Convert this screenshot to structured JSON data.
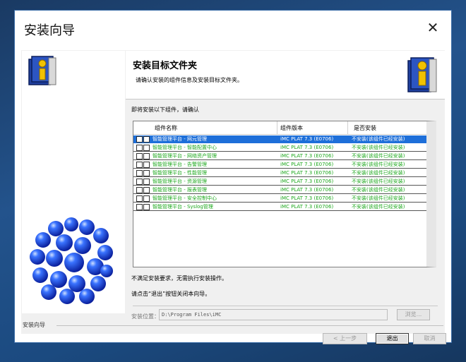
{
  "window": {
    "title": "安装向导",
    "close_glyph": "✕"
  },
  "header": {
    "title": "安装目标文件夹",
    "subtitle": "请确认安装的组件信息及安装目标文件夹。"
  },
  "body": {
    "prompt": "即将安装以下组件，请确认",
    "columns": [
      "组件名称",
      "组件版本",
      "是否安装"
    ],
    "rows": [
      {
        "name": "智能管理平台 - 网元管理",
        "version": "iMC PLAT 7.3 (E0706)",
        "status": "不安装(该组件已经安装)",
        "selected": true
      },
      {
        "name": "智能管理平台 - 智能配置中心",
        "version": "iMC PLAT 7.3 (E0706)",
        "status": "不安装(该组件已经安装)",
        "selected": false
      },
      {
        "name": "智能管理平台 - 网络资产管理",
        "version": "iMC PLAT 7.3 (E0706)",
        "status": "不安装(该组件已经安装)",
        "selected": false
      },
      {
        "name": "智能管理平台 - 告警管理",
        "version": "iMC PLAT 7.3 (E0706)",
        "status": "不安装(该组件已经安装)",
        "selected": false
      },
      {
        "name": "智能管理平台 - 性能管理",
        "version": "iMC PLAT 7.3 (E0706)",
        "status": "不安装(该组件已经安装)",
        "selected": false
      },
      {
        "name": "智能管理平台 - 资源管理",
        "version": "iMC PLAT 7.3 (E0706)",
        "status": "不安装(该组件已经安装)",
        "selected": false
      },
      {
        "name": "智能管理平台 - 报表管理",
        "version": "iMC PLAT 7.3 (E0706)",
        "status": "不安装(该组件已经安装)",
        "selected": false
      },
      {
        "name": "智能管理平台 - 安全控制中心",
        "version": "iMC PLAT 7.3 (E0706)",
        "status": "不安装(该组件已经安装)",
        "selected": false
      },
      {
        "name": "智能管理平台 - Syslog管理",
        "version": "iMC PLAT 7.3 (E0706)",
        "status": "不安装(该组件已经安装)",
        "selected": false
      }
    ],
    "msg_no_install": "不满足安装要求，无需执行安装操作。",
    "msg_exit": "请点击“退出”按钮关闭本向导。",
    "location_label": "安装位置：",
    "location_value": "D:\\Program Files\\iMC",
    "browse_label": "浏览..."
  },
  "footer": {
    "label": "安装向导",
    "back_label": "< 上一步",
    "exit_label": "退出",
    "cancel_label": "取消"
  },
  "colors": {
    "selection": "#1e6fd9",
    "row_text": "#1ea81e",
    "icon_blue": "#1f3f9e",
    "icon_yellow": "#f2c200"
  }
}
